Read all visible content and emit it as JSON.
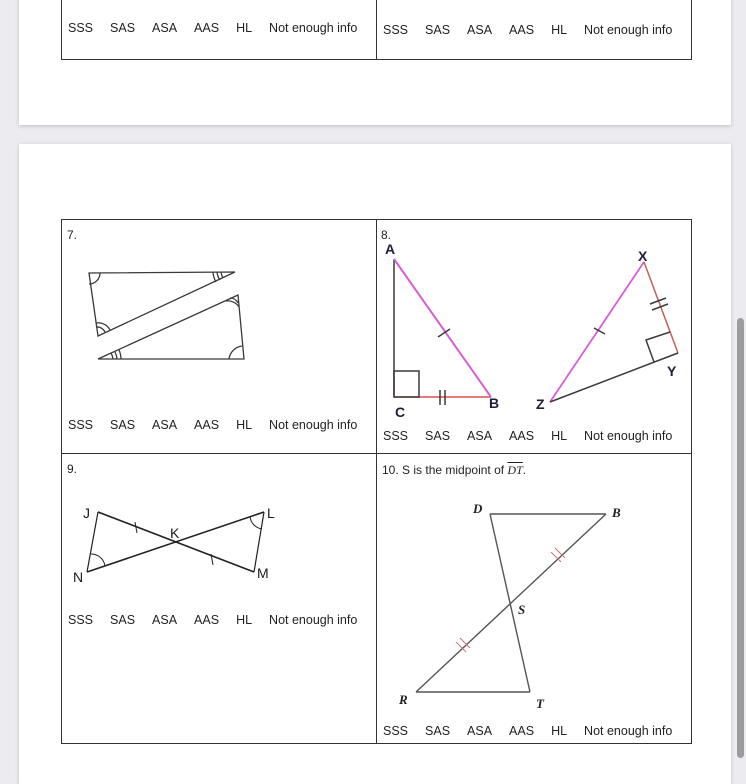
{
  "choices": [
    "SSS",
    "SAS",
    "ASA",
    "AAS",
    "HL",
    "Not enough info"
  ],
  "problems": [
    {
      "number": "7.",
      "statement": ""
    },
    {
      "number": "8.",
      "labels": {
        "A": "A",
        "B": "B",
        "C": "C",
        "X": "X",
        "Y": "Y",
        "Z": "Z"
      }
    },
    {
      "number": "9.",
      "labels": {
        "J": "J",
        "K": "K",
        "L": "L",
        "M": "M",
        "N": "N"
      }
    },
    {
      "number": "10.",
      "statement_prefix": "S is the midpoint of ",
      "segment": "DT",
      "statement_suffix": ".",
      "labels": {
        "D": "D",
        "B": "B",
        "S": "S",
        "R": "R",
        "T": "T"
      }
    }
  ],
  "colors": {
    "line": "#3a3a3a",
    "hypotenuse": "#d65fd6",
    "leg_marked": "#d9534a",
    "tick_red": "#d07070",
    "page_bg": "#ececf0"
  }
}
